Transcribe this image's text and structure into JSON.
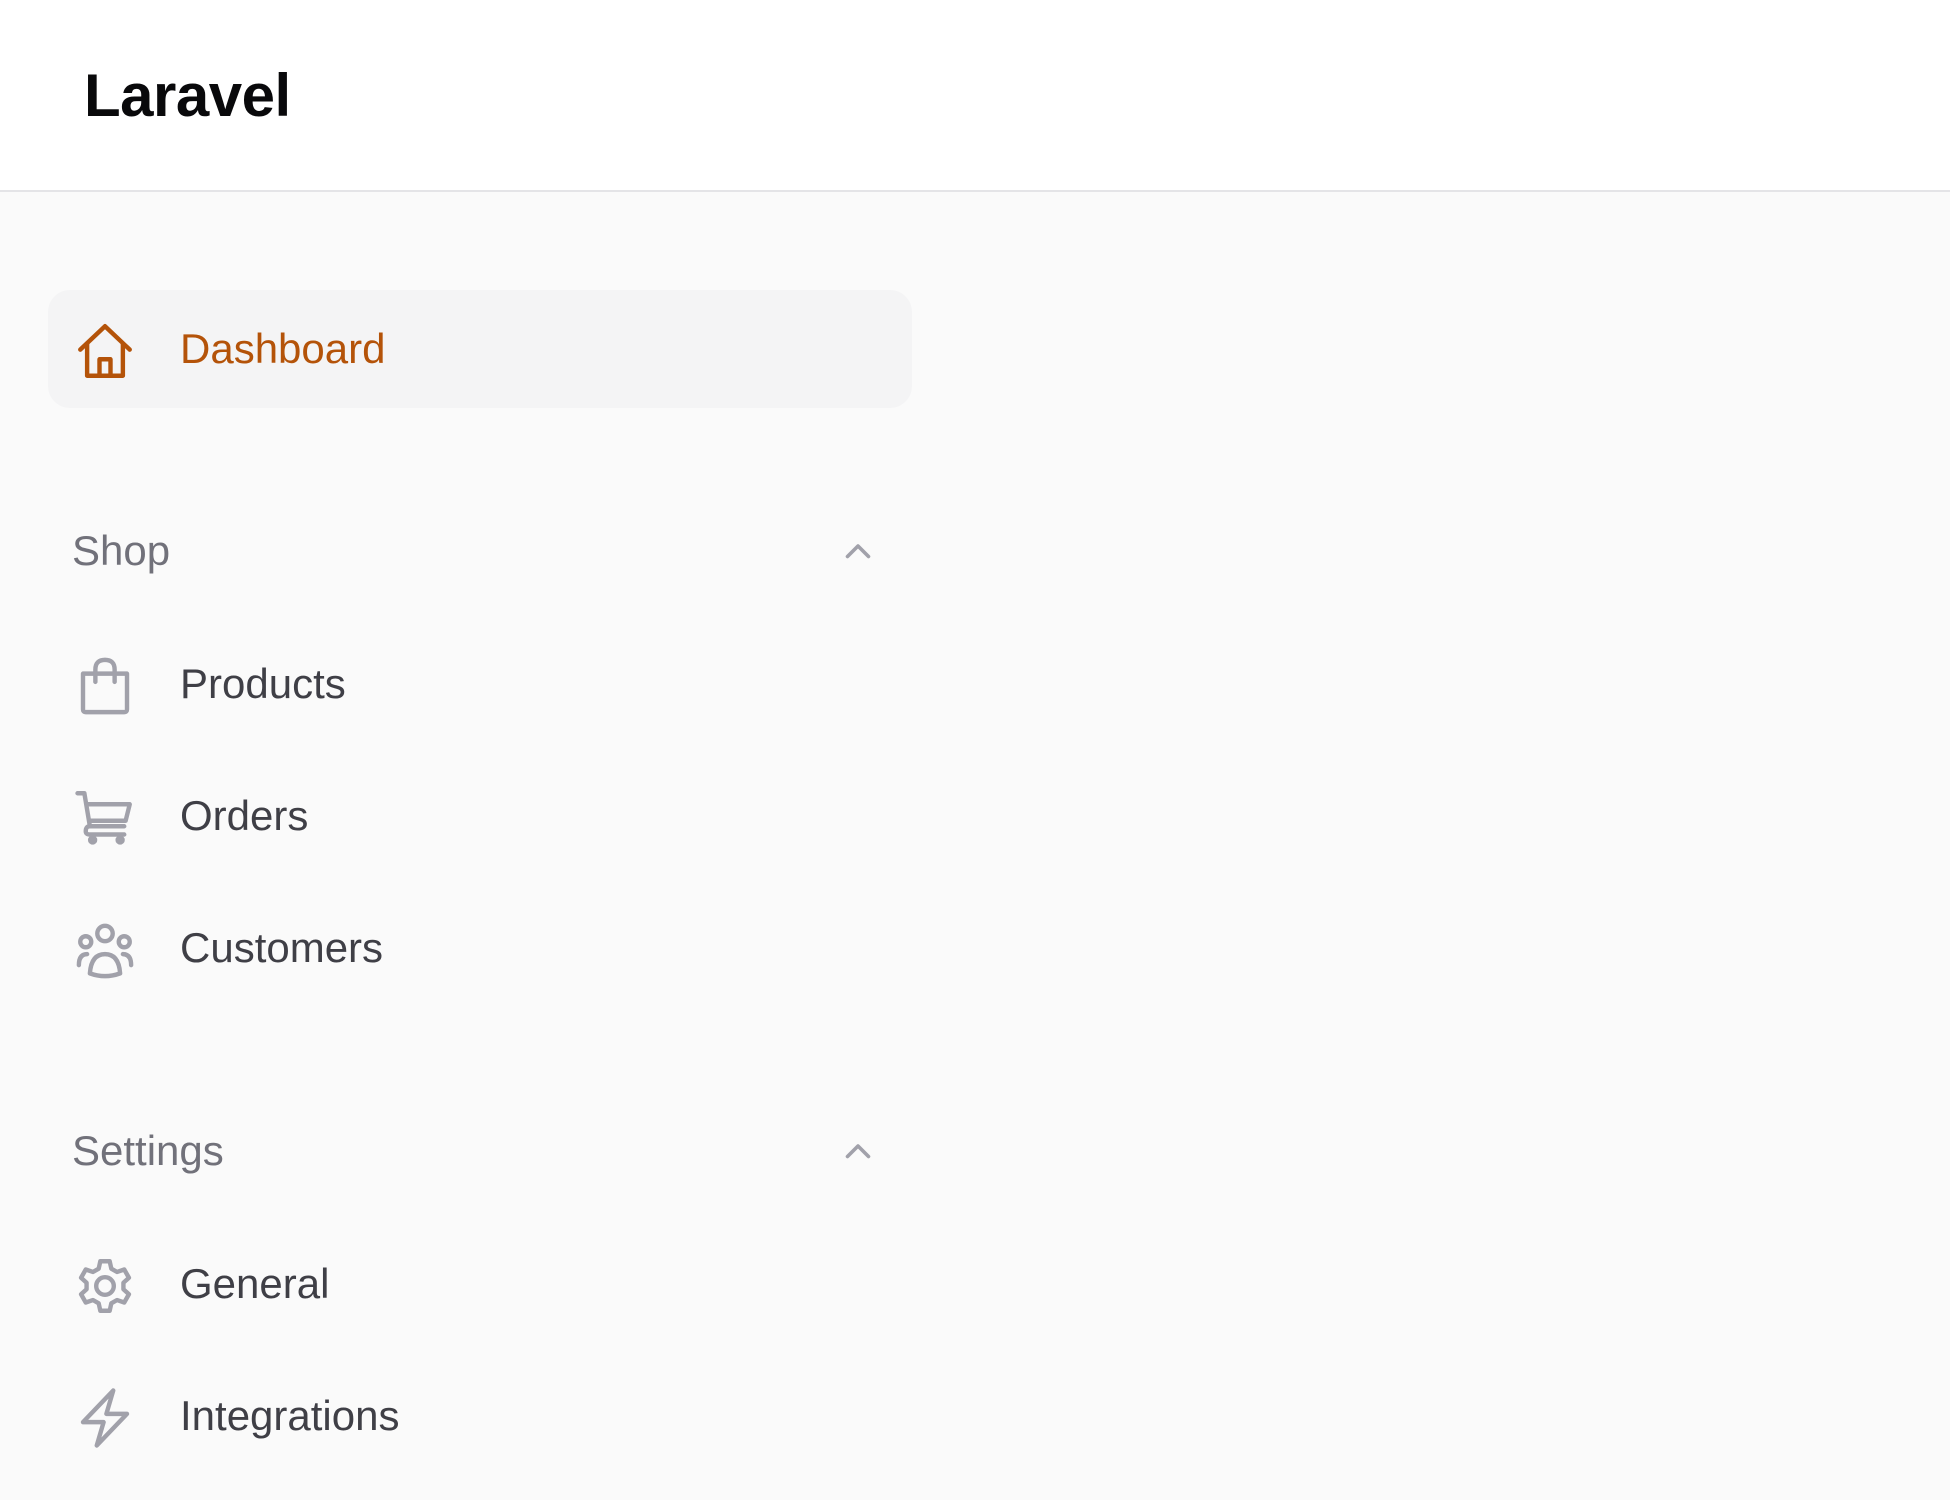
{
  "app": {
    "title": "Laravel"
  },
  "sidebar": {
    "dashboard": {
      "label": "Dashboard",
      "icon": "home-icon",
      "active": true
    },
    "groups": [
      {
        "label": "Shop",
        "expanded": true,
        "items": [
          {
            "label": "Products",
            "icon": "shopping-bag-icon"
          },
          {
            "label": "Orders",
            "icon": "shopping-cart-icon"
          },
          {
            "label": "Customers",
            "icon": "users-icon"
          }
        ]
      },
      {
        "label": "Settings",
        "expanded": true,
        "items": [
          {
            "label": "General",
            "icon": "gear-icon"
          },
          {
            "label": "Integrations",
            "icon": "bolt-icon"
          }
        ]
      }
    ]
  },
  "colors": {
    "accent": "#b45309",
    "active_bg": "#f4f4f5",
    "page_bg": "#fafafa",
    "topbar_bg": "#ffffff",
    "icon_muted": "#a1a1aa",
    "text": "#3f3f46",
    "group_text": "#71717a"
  }
}
